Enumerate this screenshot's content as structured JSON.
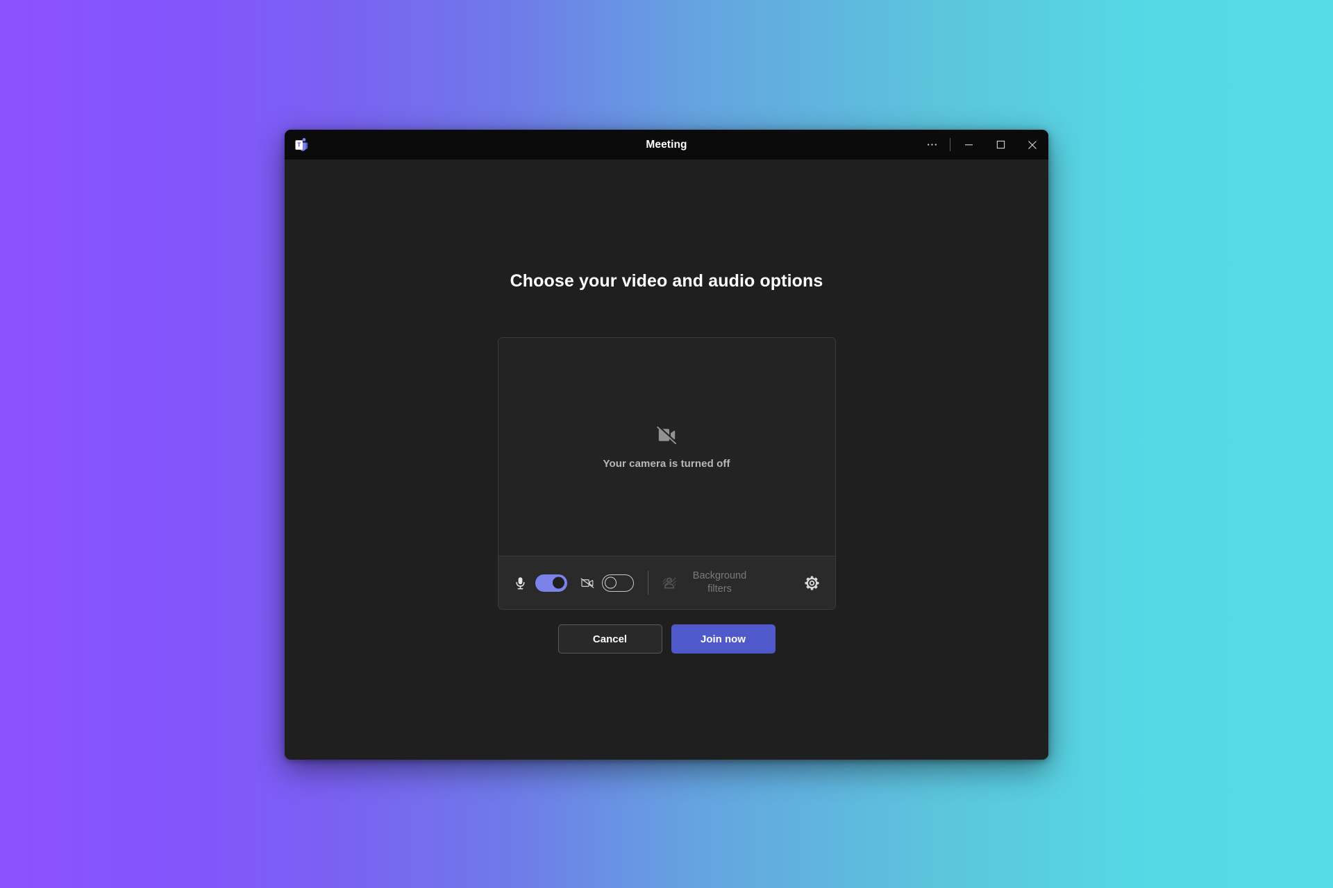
{
  "window": {
    "title": "Meeting",
    "app_logo_icon": "microsoft-teams-logo",
    "controls": {
      "more_label": "···",
      "more_icon": "more-options-icon",
      "minimize_icon": "minimize-icon",
      "maximize_icon": "maximize-icon",
      "close_icon": "close-icon"
    }
  },
  "dialog": {
    "heading": "Choose your video and audio options",
    "preview": {
      "camera_icon": "camera-off-icon",
      "status_text": "Your camera is turned off"
    },
    "controls": {
      "mic_icon": "microphone-icon",
      "mic_toggle_state": "on",
      "camera_icon": "camera-off-icon",
      "camera_toggle_state": "off",
      "background_filters_icon": "background-blur-icon",
      "background_filters_label": "Background filters",
      "background_filters_disabled": true,
      "settings_icon": "gear-icon"
    },
    "actions": {
      "cancel_label": "Cancel",
      "join_label": "Join now"
    }
  },
  "colors": {
    "accent_purple": "#5059c9",
    "toggle_on": "#7b83eb",
    "window_body": "#1f1f1f",
    "title_bar": "#0b0b0b",
    "backdrop_start": "#8c52ff",
    "backdrop_end": "#55d9e5"
  }
}
